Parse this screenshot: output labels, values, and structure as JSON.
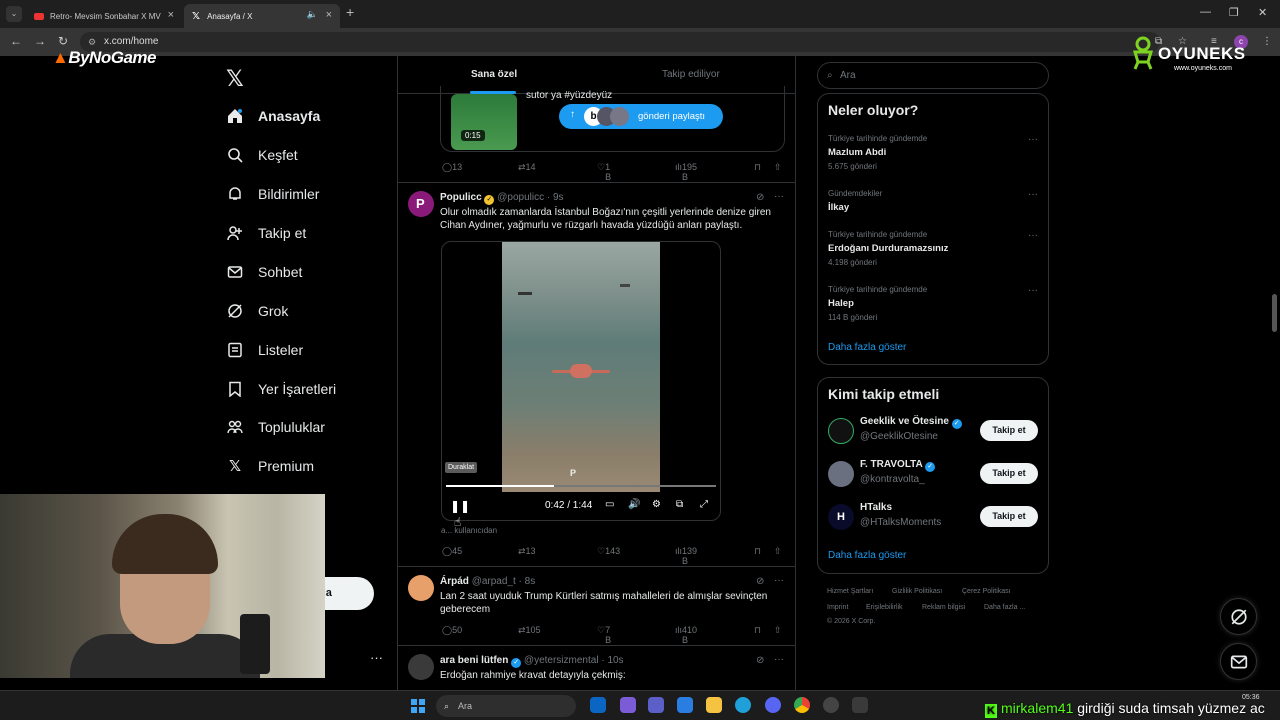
{
  "browser": {
    "tabs": [
      {
        "title": "Retro- Mevsim Sonbahar X MV",
        "icon": "youtube-icon"
      },
      {
        "title": "Anasayfa / X",
        "icon": "x-icon"
      }
    ],
    "url": "x.com/home"
  },
  "overlays": {
    "bynogame": "ByNoGame",
    "oyuneks_name": "OYUNEKS",
    "oyuneks_url": "www.oyuneks.com"
  },
  "nav": {
    "items": [
      {
        "label": "Anasayfa",
        "icon": "home-icon"
      },
      {
        "label": "Keşfet",
        "icon": "search-icon"
      },
      {
        "label": "Bildirimler",
        "icon": "bell-icon"
      },
      {
        "label": "Takip et",
        "icon": "add-person-icon"
      },
      {
        "label": "Sohbet",
        "icon": "mail-icon"
      },
      {
        "label": "Grok",
        "icon": "grok-icon"
      },
      {
        "label": "Listeler",
        "icon": "list-icon"
      },
      {
        "label": "Yer İşaretleri",
        "icon": "bookmark-icon"
      },
      {
        "label": "Topluluklar",
        "icon": "communities-icon"
      },
      {
        "label": "Premium",
        "icon": "x-icon"
      }
    ],
    "post_label": "nla",
    "more": "···"
  },
  "feed": {
    "tabs": [
      "Sana özel",
      "Takip ediliyor"
    ],
    "tweet0": {
      "text": "sutor ya #yüzdeyüz",
      "video_duration": "0:15",
      "share_label": "gönderi paylaştı",
      "replies": "13",
      "retweets": "14",
      "likes": "1 B",
      "views": "195 B"
    },
    "tweet1": {
      "name": "Populicc",
      "handle": "@populicc",
      "time": "9s",
      "text": "Olur olmadık zamanlarda İstanbul Boğazı'nın çeşitli yerlerinde denize giren Cihan Aydıner, yağmurlu ve rüzgarlı havada yüzdüğü anları paylaştı.",
      "video_tooltip": "Duraklat",
      "video_time": "0:42 / 1:44",
      "video_progress": 0.4,
      "source": "a... kullanıcıdan",
      "replies": "45",
      "retweets": "13",
      "likes": "143",
      "views": "139 B"
    },
    "tweet2": {
      "name": "Árpád",
      "handle": "@arpad_t",
      "time": "8s",
      "text": "Lan 2 saat uyuduk Trump Kürtleri satmış mahalleleri de almışlar sevinçten geberecem",
      "replies": "50",
      "retweets": "105",
      "likes": "7 B",
      "views": "410 B"
    },
    "tweet3": {
      "name": "ara beni lütfen",
      "handle": "@yetersizmental",
      "time": "10s",
      "text": "Erdoğan rahmiye kravat detayıyla çekmiş:"
    }
  },
  "sidebar": {
    "search_placeholder": "Ara",
    "trends_title": "Neler oluyor?",
    "trends": [
      {
        "context": "Türkiye tarihinde gündemde",
        "title": "Mazlum Abdi",
        "count": "5.675 gönderi"
      },
      {
        "context": "Gündemdekiler",
        "title": "İlkay",
        "count": ""
      },
      {
        "context": "Türkiye tarihinde gündemde",
        "title": "Erdoğanı Durduramazsınız",
        "count": "4.198 gönderi"
      },
      {
        "context": "Türkiye tarihinde gündemde",
        "title": "Halep",
        "count": "114 B gönderi"
      }
    ],
    "show_more": "Daha fazla göster",
    "who_title": "Kimi takip etmeli",
    "who": [
      {
        "name": "Geeklik ve Ötesine",
        "handle": "@GeeklikOtesine",
        "button": "Takip et"
      },
      {
        "name": "F. TRAVOLTA",
        "handle": "@kontravolta_",
        "button": "Takip et"
      },
      {
        "name": "HTalks",
        "handle": "@HTalksMoments",
        "button": "Takip et"
      }
    ],
    "footer": [
      "Hizmet Şartları",
      "Gizlilik Politikası",
      "Çerez Politikası",
      "Imprint",
      "Erişilebilirlik",
      "Reklam bilgisi",
      "Daha fazla ...",
      "© 2026 X Corp."
    ]
  },
  "taskbar": {
    "search": "Ara",
    "clock_time": "05:36",
    "chat_user": "mirkalem41",
    "chat_message": "girdiği suda timsah yüzmez ac"
  },
  "colors": {
    "accent": "#1d9bf0",
    "background": "#000000",
    "kick_green": "#53fc18"
  }
}
